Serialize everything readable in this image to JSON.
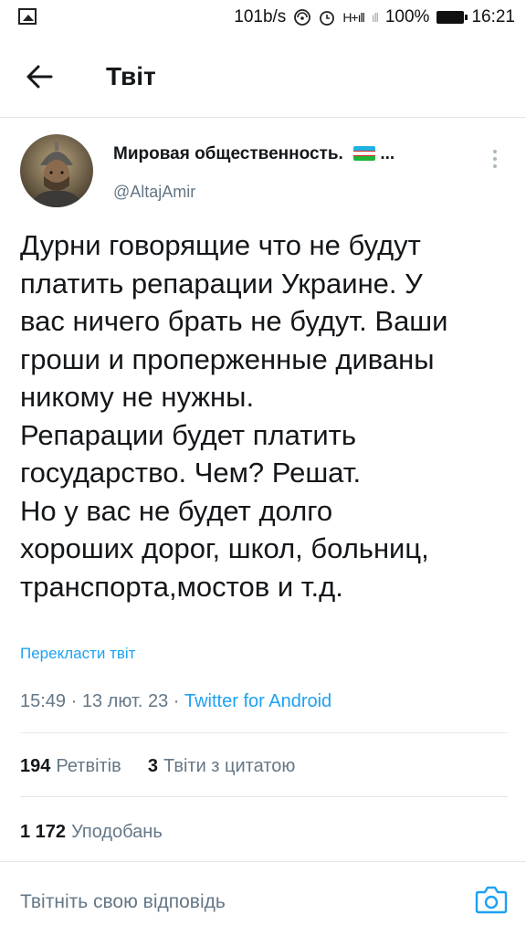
{
  "status_bar": {
    "speed": "101b/s",
    "signal_1": "H+ıll",
    "signal_2": "ıll",
    "battery": "100%",
    "time": "16:21"
  },
  "header": {
    "title": "Твіт"
  },
  "tweet": {
    "author_name": "Мировая общественность.",
    "author_name_suffix": "...",
    "handle": "@AltajAmir",
    "text_lines": [
      "Дурни говорящие что не будут",
      "платить репарации Украине. У",
      "вас ничего брать не будут. Ваши",
      "гроши и проперженные диваны",
      "никому не нужны.",
      "Репарации будет платить",
      "государство. Чем? Решат.",
      "Но у вас не будет долго",
      "хороших дорог, школ, больниц,",
      "транспорта,мостов и т.д."
    ],
    "translate_link": "Перекласти твіт",
    "time": "15:49",
    "date": "13 лют. 23",
    "separator": "·",
    "source": "Twitter for Android"
  },
  "stats": {
    "retweets_count": "194",
    "retweets_label": "Ретвітів",
    "quotes_count": "3",
    "quotes_label": "Твіти з цитатою",
    "likes_count": "1 172",
    "likes_label": "Уподобань"
  },
  "reply": {
    "placeholder": "Твітніть свою відповідь"
  },
  "colors": {
    "accent": "#1da1f2",
    "secondary_text": "#657786",
    "divider": "#e1e8ed"
  },
  "icons": [
    "image-icon",
    "wifi-icon",
    "alarm-icon",
    "battery-icon",
    "back-arrow-icon",
    "uzbekistan-flag-icon",
    "more-vertical-icon",
    "camera-icon"
  ]
}
